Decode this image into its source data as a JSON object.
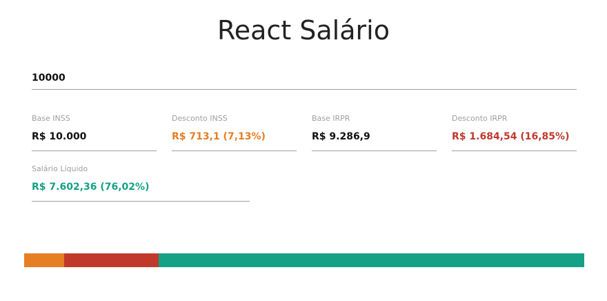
{
  "header": {
    "title": "React Salário"
  },
  "input": {
    "value": "10000"
  },
  "fields": {
    "base_inss": {
      "label": "Base INSS",
      "value": "R$ 10.000",
      "color": "#111111"
    },
    "desconto_inss": {
      "label": "Desconto INSS",
      "value": "R$ 713,1 (7,13%)",
      "color": "#e67e22"
    },
    "base_irpf": {
      "label": "Base IRPR",
      "value": "R$ 9.286,9",
      "color": "#111111"
    },
    "desconto_irpf": {
      "label": "Desconto IRPR",
      "value": "R$ 1.684,54 (16,85%)",
      "color": "#c0392b"
    },
    "liquido": {
      "label": "Salário Líquido",
      "value": "R$ 7.602,36 (76,02%)",
      "color": "#16a085"
    }
  },
  "bar": {
    "segments": [
      {
        "name": "desconto-inss",
        "percent": 7.13,
        "color": "#e67e22"
      },
      {
        "name": "desconto-irpf",
        "percent": 16.85,
        "color": "#c0392b"
      },
      {
        "name": "salario-liquido",
        "percent": 76.02,
        "color": "#16a085"
      }
    ]
  }
}
